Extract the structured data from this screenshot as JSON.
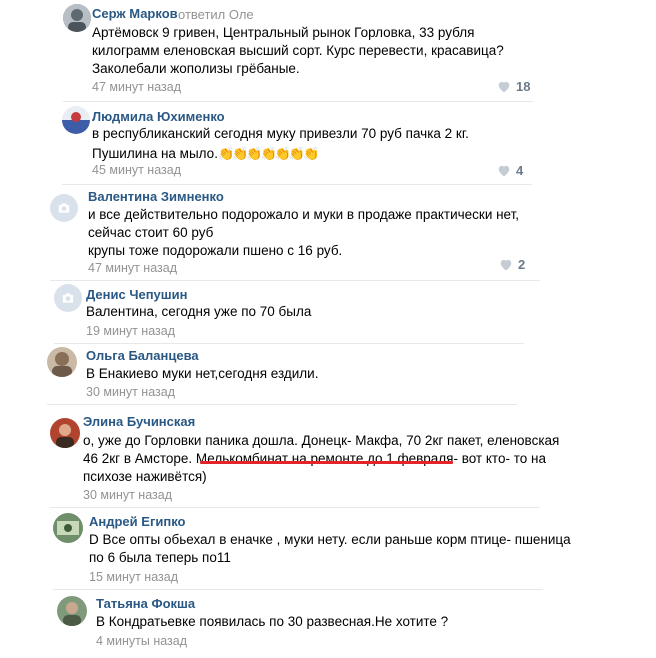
{
  "comments": [
    {
      "author": "Серж Марков",
      "reply": "ответил Оле",
      "lines": [
        "Артёмовск 9 гривен, Центральный рынок Горловка, 33 рубля",
        "килограмм еленовская высший сорт. Курс перевести, красавица?",
        "Заколебали жополизы грёбаные."
      ],
      "time": "47 минут назад",
      "likes": "18"
    },
    {
      "author": "Людмила Юхименко",
      "lines": [
        "в республиканский сегодня муку привезли 70 руб пачка 2 кг.",
        "Пушилина на мыло."
      ],
      "claps": "👏👏👏👏👏👏👏",
      "time": "45 минут назад",
      "likes": "4"
    },
    {
      "author": "Валентина Зимненко",
      "lines": [
        "и все действительно подорожало и муки в  продаже практически нет,",
        "сейчас  стоит 60 руб",
        "крупы тоже подорожали пшено с 16 руб."
      ],
      "time": "47 минут назад",
      "likes": "2"
    },
    {
      "author": "Денис Чепушин",
      "lines": [
        "Валентина, сегодня уже по 70 была"
      ],
      "time": "19 минут назад"
    },
    {
      "author": "Ольга Баланцева",
      "lines": [
        "В Енакиево муки нет,сегодня ездили."
      ],
      "time": "30 минут назад"
    },
    {
      "author": "Элина Бучинская",
      "lines": [
        "о, уже до Горловки паника дошла. Донецк- Макфа, 70 2кг пакет, еленовская",
        "46 2кг в Амсторе. Мелькомбинат на ремонте до 1 февраля- вот кто- то на",
        "психозе наживётся)"
      ],
      "time": "30 минут назад"
    },
    {
      "author": "Андрей Египко",
      "lines": [
        "D Все опты обьехал в еначке , муки нету. если раньше корм птице- пшеница",
        "по 6 была теперь по11"
      ],
      "time": "15 минут назад"
    },
    {
      "author": "Татьяна Фокша",
      "lines": [
        "В Кондратьевке появилась по 30 развесная.Не хотите ?"
      ],
      "time": "4 минуты назад"
    }
  ],
  "colors": {
    "author": "#2a5885",
    "meta": "#939393",
    "highlight": "#e5242a",
    "separator": "#e7e8ec"
  },
  "icons": {
    "like": "heart-icon",
    "placeholder_avatar": "camera-icon"
  }
}
